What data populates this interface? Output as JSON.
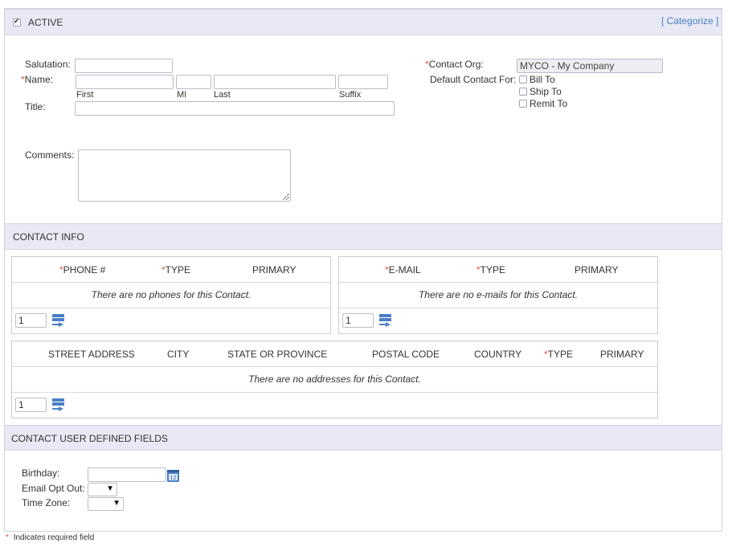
{
  "active": {
    "label": "ACTIVE",
    "checked": true
  },
  "categorize_link": "[ Categorize ]",
  "form": {
    "salutation_label": "Salutation:",
    "name_label": "Name:",
    "title_label": "Title:",
    "name_parts": {
      "first": "First",
      "mi": "MI",
      "last": "Last",
      "suffix": "Suffix"
    },
    "comments_label": "Comments:",
    "contact_org_label": "Contact Org:",
    "contact_org_value": "MYCO - My Company",
    "default_contact_label": "Default Contact For:",
    "default_options": [
      "Bill To",
      "Ship To",
      "Remit To"
    ]
  },
  "contact_info": {
    "title": "CONTACT INFO",
    "phones": {
      "columns": [
        "PHONE #",
        "TYPE",
        "PRIMARY"
      ],
      "empty": "There are no phones for this Contact.",
      "count": "1"
    },
    "emails": {
      "columns": [
        "E-MAIL",
        "TYPE",
        "PRIMARY"
      ],
      "empty": "There are no e-mails for this Contact.",
      "count": "1"
    },
    "addresses": {
      "columns": [
        "STREET ADDRESS",
        "CITY",
        "STATE OR PROVINCE",
        "POSTAL CODE",
        "COUNTRY",
        "TYPE",
        "PRIMARY"
      ],
      "empty": "There are no addresses for this Contact.",
      "count": "1"
    }
  },
  "udf": {
    "title": "CONTACT USER DEFINED FIELDS",
    "birthday_label": "Birthday:",
    "email_opt_out_label": "Email Opt Out:",
    "time_zone_label": "Time Zone:",
    "email_opt_out_value": "",
    "time_zone_value": ""
  },
  "footer": {
    "required_note": "Indicates required field",
    "asterisk": "*"
  },
  "colors": {
    "band": "#e8e9f4",
    "accent_link": "#4a7fc6",
    "required": "#d9534f",
    "icon_blue": "#4a7fc6"
  }
}
